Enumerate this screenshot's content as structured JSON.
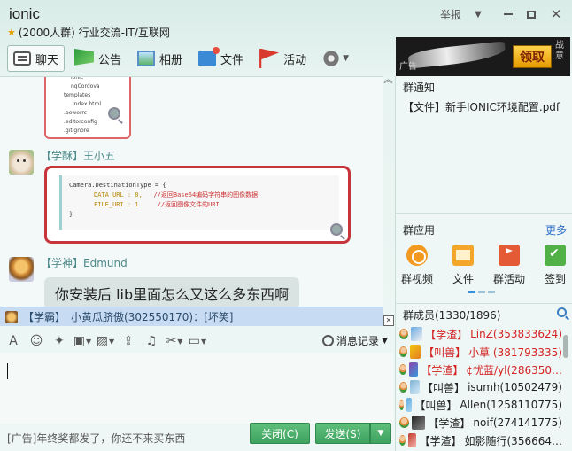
{
  "window": {
    "title": "ionic",
    "subtitle": "(2000人群) 行业交流-IT/互联网",
    "report_label": "举报",
    "close_glyph": "✕"
  },
  "toolbar": {
    "items": [
      {
        "label": "聊天",
        "icon": "chat-icon"
      },
      {
        "label": "公告",
        "icon": "notice-flag-icon"
      },
      {
        "label": "相册",
        "icon": "album-icon"
      },
      {
        "label": "文件",
        "icon": "folder-icon"
      },
      {
        "label": "活动",
        "icon": "event-flag-icon"
      }
    ]
  },
  "top_ad": {
    "tag": "广告",
    "button": "领取",
    "close": "战意"
  },
  "chat": {
    "file_tree": [
      "ionic",
      "ngCordova",
      "templates",
      "index.html",
      ".bowerrc",
      ".editorconfig",
      ".gitignore"
    ],
    "messages": [
      {
        "level": "【学酥】",
        "sender": "王小五",
        "code": [
          "Camera.DestinationType = {",
          "DATA_URL : 0,",
          "//返回Base64编码字符串的图像数据",
          "FILE_URI : 1",
          "//返回图像文件的URI",
          "}"
        ]
      },
      {
        "level": "【学神】",
        "sender": "Edmund",
        "text": "你安装后 lib里面怎么又这么多东西啊"
      }
    ]
  },
  "notification": {
    "level": "【学霸】",
    "text": "小黄瓜脐傲(302550170)：[坏笑]"
  },
  "input": {
    "history_label": "消息记录",
    "bottom_ad": "[广告]年终奖都发了，你还不来买东西",
    "close_button": "关闭(C)",
    "send_button": "发送(S)"
  },
  "right_panel": {
    "notice_title": "群通知",
    "notice_item": "【文件】新手IONIC环境配置.pdf",
    "apps_title": "群应用",
    "apps_more": "更多",
    "apps": [
      {
        "label": "群视频",
        "icon": "video-icon"
      },
      {
        "label": "文件",
        "icon": "file-icon"
      },
      {
        "label": "群活动",
        "icon": "event-icon"
      },
      {
        "label": "签到",
        "icon": "checkin-icon"
      }
    ],
    "members_title": "群成员(1330/1896)",
    "members": [
      {
        "level": "【学渣】",
        "name": "LinZ(353833624)",
        "red": true
      },
      {
        "level": "【叫兽】",
        "name": "小草 (381793335)",
        "red": true
      },
      {
        "level": "【学渣】",
        "name": "¢忧蓝/yl(286350…",
        "red": true
      },
      {
        "level": "【叫兽】",
        "name": "isumh(10502479)",
        "red": false
      },
      {
        "level": "【叫兽】",
        "name": "Allen(1258110775)",
        "red": false
      },
      {
        "level": "【学渣】",
        "name": "noif(274141775)",
        "red": false
      },
      {
        "level": "【学渣】",
        "name": "如影随行(356664…",
        "red": false
      }
    ]
  }
}
